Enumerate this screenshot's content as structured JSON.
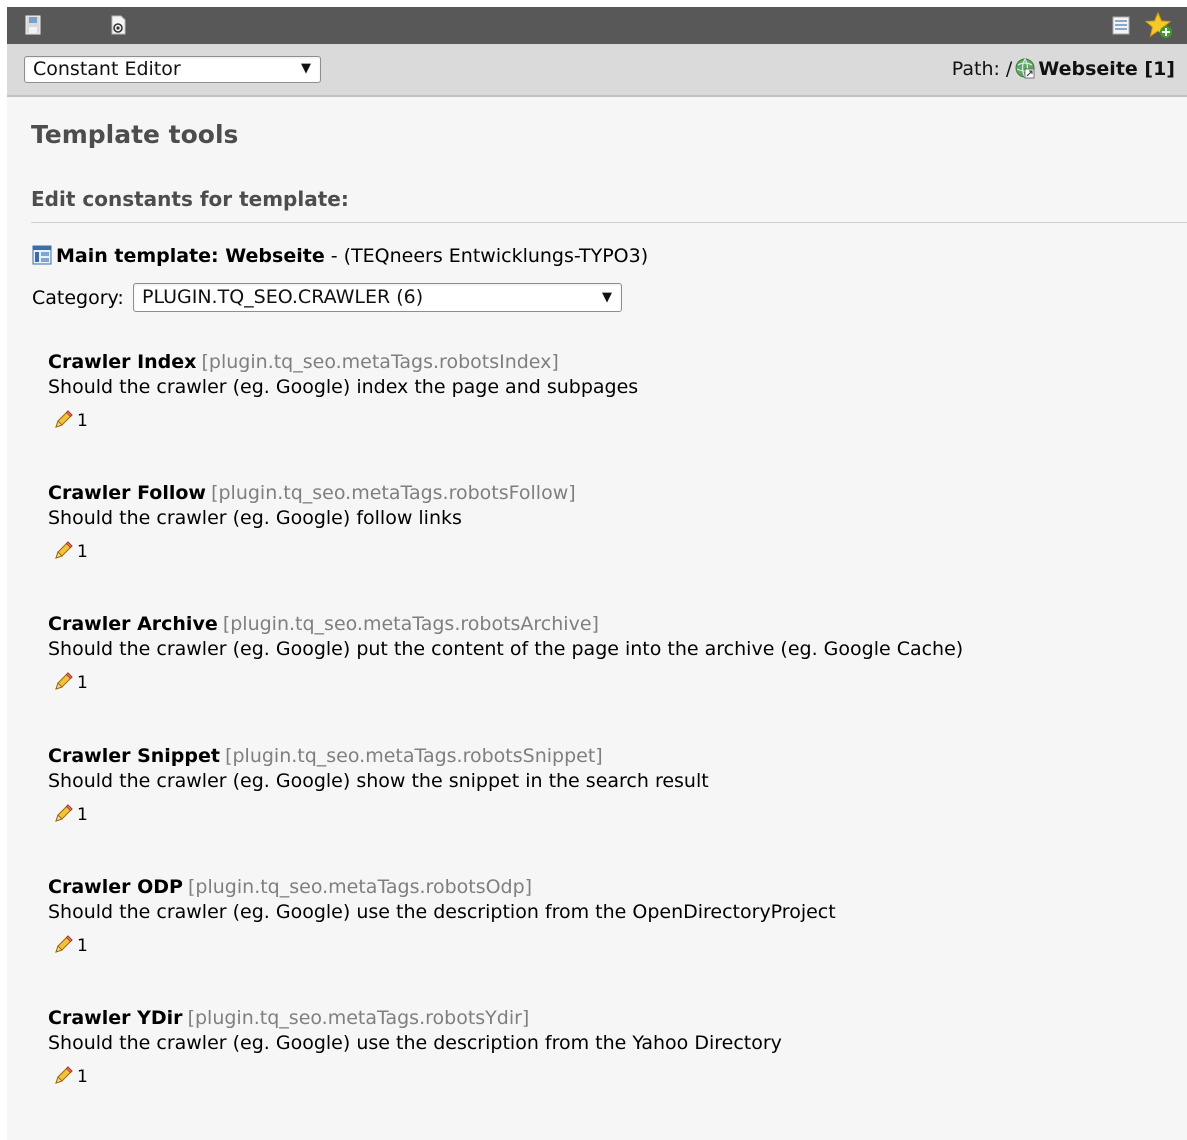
{
  "toolbar": {
    "left_icons": [
      "save-icon",
      "view-page-icon"
    ],
    "right_icons": [
      "list-icon",
      "add-bookmark-star-icon"
    ]
  },
  "docheader": {
    "function_select": "Constant Editor",
    "path_label": "Path: /",
    "path_page": "Webseite [1]"
  },
  "content": {
    "title": "Template tools",
    "subtitle": "Edit constants for template:",
    "template_label": "Main template: Webseite",
    "template_suffix": " - (TEQneers Entwicklungs-TYPO3)",
    "category_label": "Category:",
    "category_value": "PLUGIN.TQ_SEO.CRAWLER (6)"
  },
  "constants": [
    {
      "name": "Crawler Index",
      "key": "[plugin.tq_seo.metaTags.robotsIndex]",
      "desc": "Should the crawler (eg. Google) index the page and subpages",
      "value": "1"
    },
    {
      "name": "Crawler Follow",
      "key": "[plugin.tq_seo.metaTags.robotsFollow]",
      "desc": "Should the crawler (eg. Google) follow links",
      "value": "1"
    },
    {
      "name": "Crawler Archive",
      "key": "[plugin.tq_seo.metaTags.robotsArchive]",
      "desc": "Should the crawler (eg. Google) put the content of the page into the archive (eg. Google Cache)",
      "value": "1"
    },
    {
      "name": "Crawler Snippet",
      "key": "[plugin.tq_seo.metaTags.robotsSnippet]",
      "desc": "Should the crawler (eg. Google) show the snippet in the search result",
      "value": "1"
    },
    {
      "name": "Crawler ODP",
      "key": "[plugin.tq_seo.metaTags.robotsOdp]",
      "desc": "Should the crawler (eg. Google) use the description from the OpenDirectoryProject",
      "value": "1"
    },
    {
      "name": "Crawler YDir",
      "key": "[plugin.tq_seo.metaTags.robotsYdir]",
      "desc": "Should the crawler (eg. Google) use the description from the Yahoo Directory",
      "value": "1"
    }
  ]
}
